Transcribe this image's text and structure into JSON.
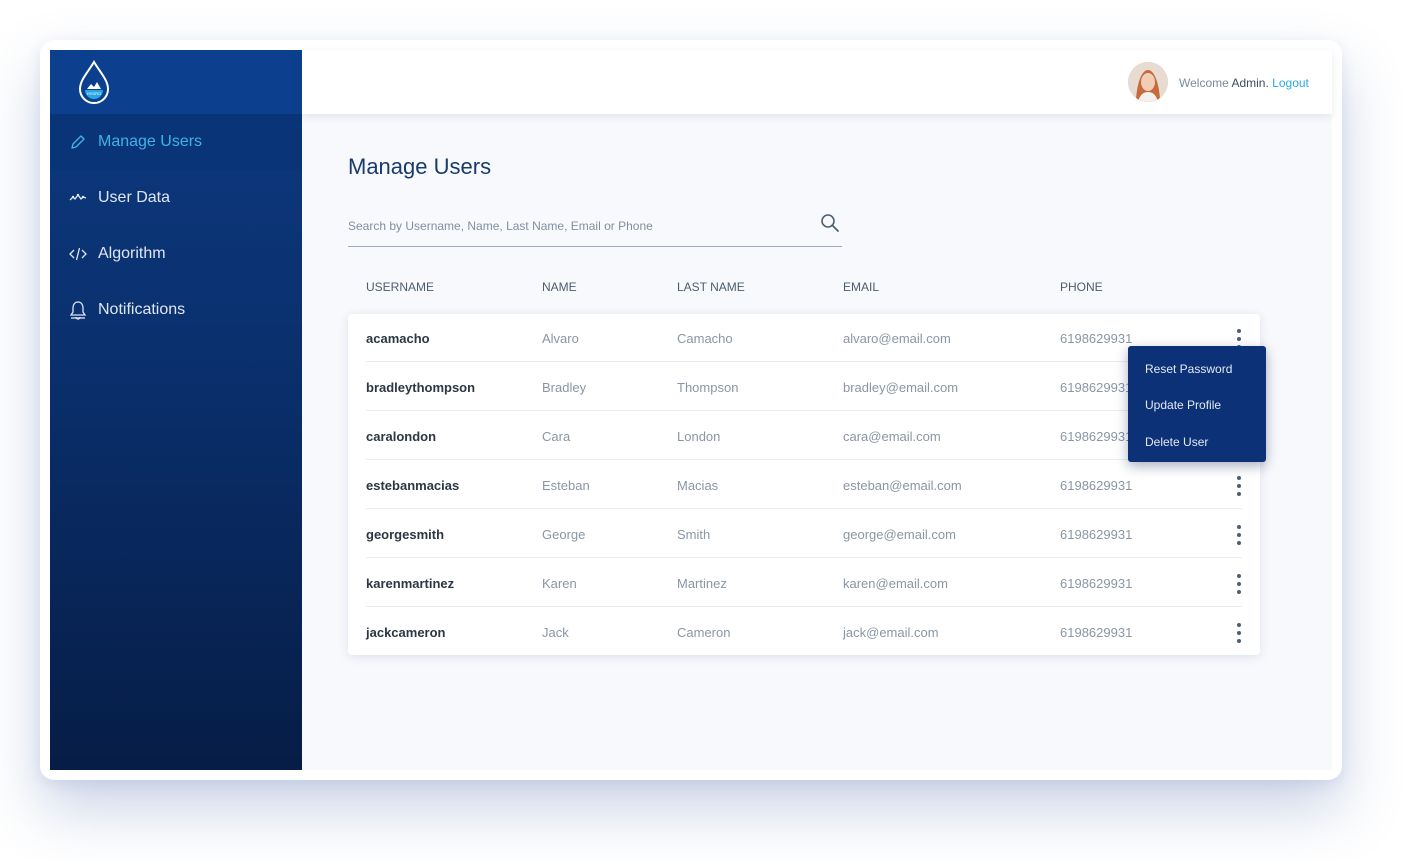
{
  "sidebar": {
    "logo_text": "HYDRO",
    "items": [
      {
        "label": "Manage Users",
        "icon": "pencil-icon",
        "active": true
      },
      {
        "label": "User Data",
        "icon": "line-chart-icon",
        "active": false
      },
      {
        "label": "Algorithm",
        "icon": "code-icon",
        "active": false
      },
      {
        "label": "Notifications",
        "icon": "bell-icon",
        "active": false
      }
    ]
  },
  "header": {
    "welcome": "Welcome",
    "user": "Admin.",
    "logout": "Logout"
  },
  "main": {
    "title": "Manage Users",
    "search_placeholder": "Search by Username, Name, Last Name, Email or Phone"
  },
  "table": {
    "columns": [
      "USERNAME",
      "NAME",
      "LAST NAME",
      "EMAIL",
      "PHONE"
    ],
    "rows": [
      {
        "username": "acamacho",
        "name": "Alvaro",
        "last_name": "Camacho",
        "email": "alvaro@email.com",
        "phone": "6198629931"
      },
      {
        "username": "bradleythompson",
        "name": "Bradley",
        "last_name": "Thompson",
        "email": "bradley@email.com",
        "phone": "6198629931"
      },
      {
        "username": "caralondon",
        "name": "Cara",
        "last_name": "London",
        "email": "cara@email.com",
        "phone": "6198629931"
      },
      {
        "username": "estebanmacias",
        "name": "Esteban",
        "last_name": "Macias",
        "email": "esteban@email.com",
        "phone": "6198629931"
      },
      {
        "username": "georgesmith",
        "name": "George",
        "last_name": "Smith",
        "email": "george@email.com",
        "phone": "6198629931"
      },
      {
        "username": "karenmartinez",
        "name": "Karen",
        "last_name": "Martinez",
        "email": "karen@email.com",
        "phone": "6198629931"
      },
      {
        "username": "jackcameron",
        "name": "Jack",
        "last_name": "Cameron",
        "email": "jack@email.com",
        "phone": "6198629931"
      }
    ]
  },
  "context_menu": {
    "items": [
      "Reset Password",
      "Update Profile",
      "Delete User"
    ]
  },
  "colors": {
    "sidebar": "#0c3f8e",
    "active_text": "#3fb2ea",
    "accent": "#2aa9e0",
    "menu_bg": "#0c3177"
  }
}
